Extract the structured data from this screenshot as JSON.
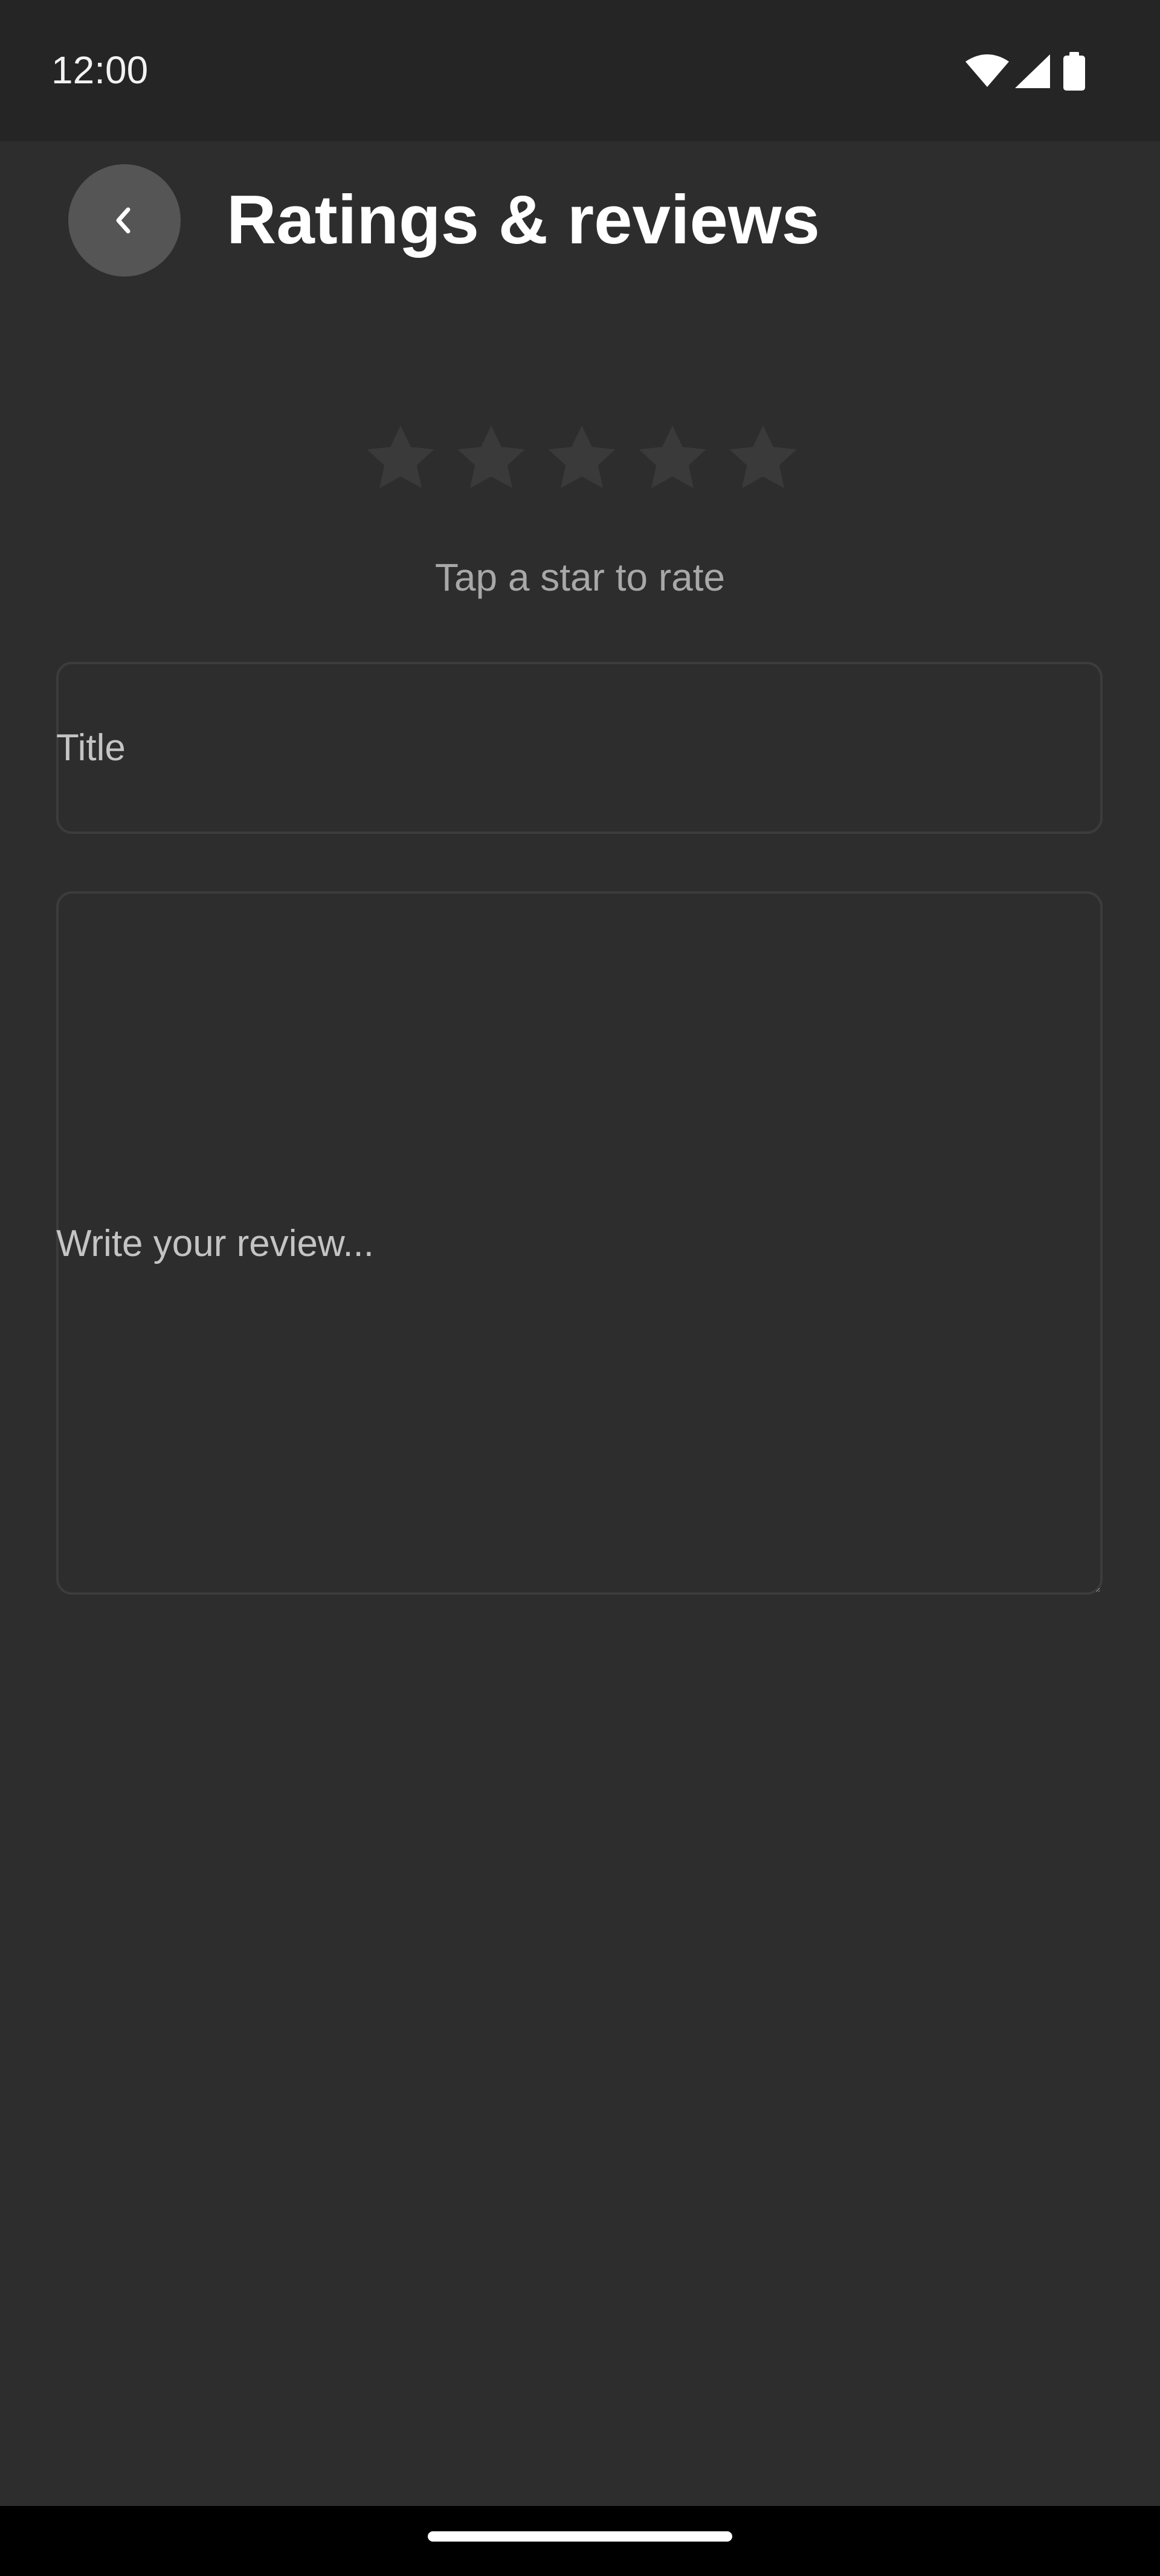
{
  "status_bar": {
    "time": "12:00",
    "icons": [
      "wifi-icon",
      "cellular-signal-icon",
      "battery-icon"
    ]
  },
  "header": {
    "back_icon": "chevron-left-icon",
    "title": "Ratings & reviews"
  },
  "rating": {
    "stars_total": 5,
    "stars_selected": 0,
    "hint": "Tap a star to rate"
  },
  "form": {
    "title_placeholder": "Title",
    "review_placeholder": "Write your review..."
  },
  "colors": {
    "background": "#2d2d2d",
    "status_bar": "#252525",
    "back_button": "#555555",
    "star_inactive": "#3a3a3a",
    "hint_text": "#a8a8a8",
    "field_border": "#3c3c3c",
    "nav_bar": "#000000"
  }
}
